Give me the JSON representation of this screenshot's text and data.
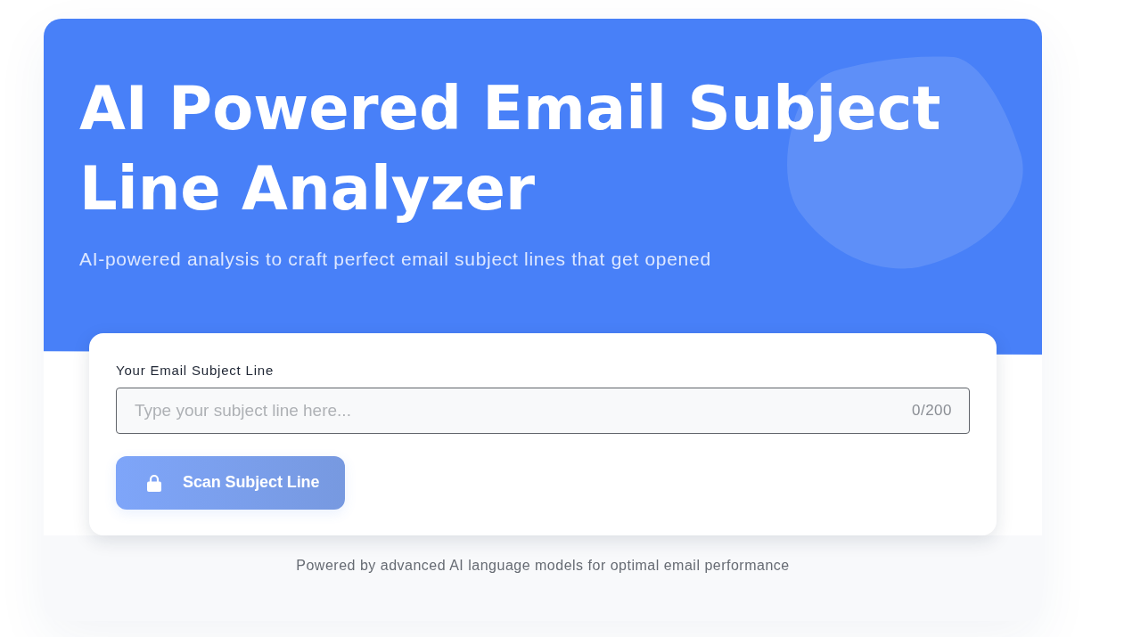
{
  "hero": {
    "title": "AI Powered Email Subject Line Analyzer",
    "subtitle": "AI-powered analysis to craft perfect email subject lines that get opened"
  },
  "form": {
    "label": "Your Email Subject Line",
    "input": {
      "placeholder": "Type your subject line here...",
      "counter": "0/200"
    },
    "button": {
      "label": "Scan Subject Line",
      "disabled": true
    }
  },
  "footer": {
    "text": "Powered by advanced AI language models for optimal email performance"
  }
}
